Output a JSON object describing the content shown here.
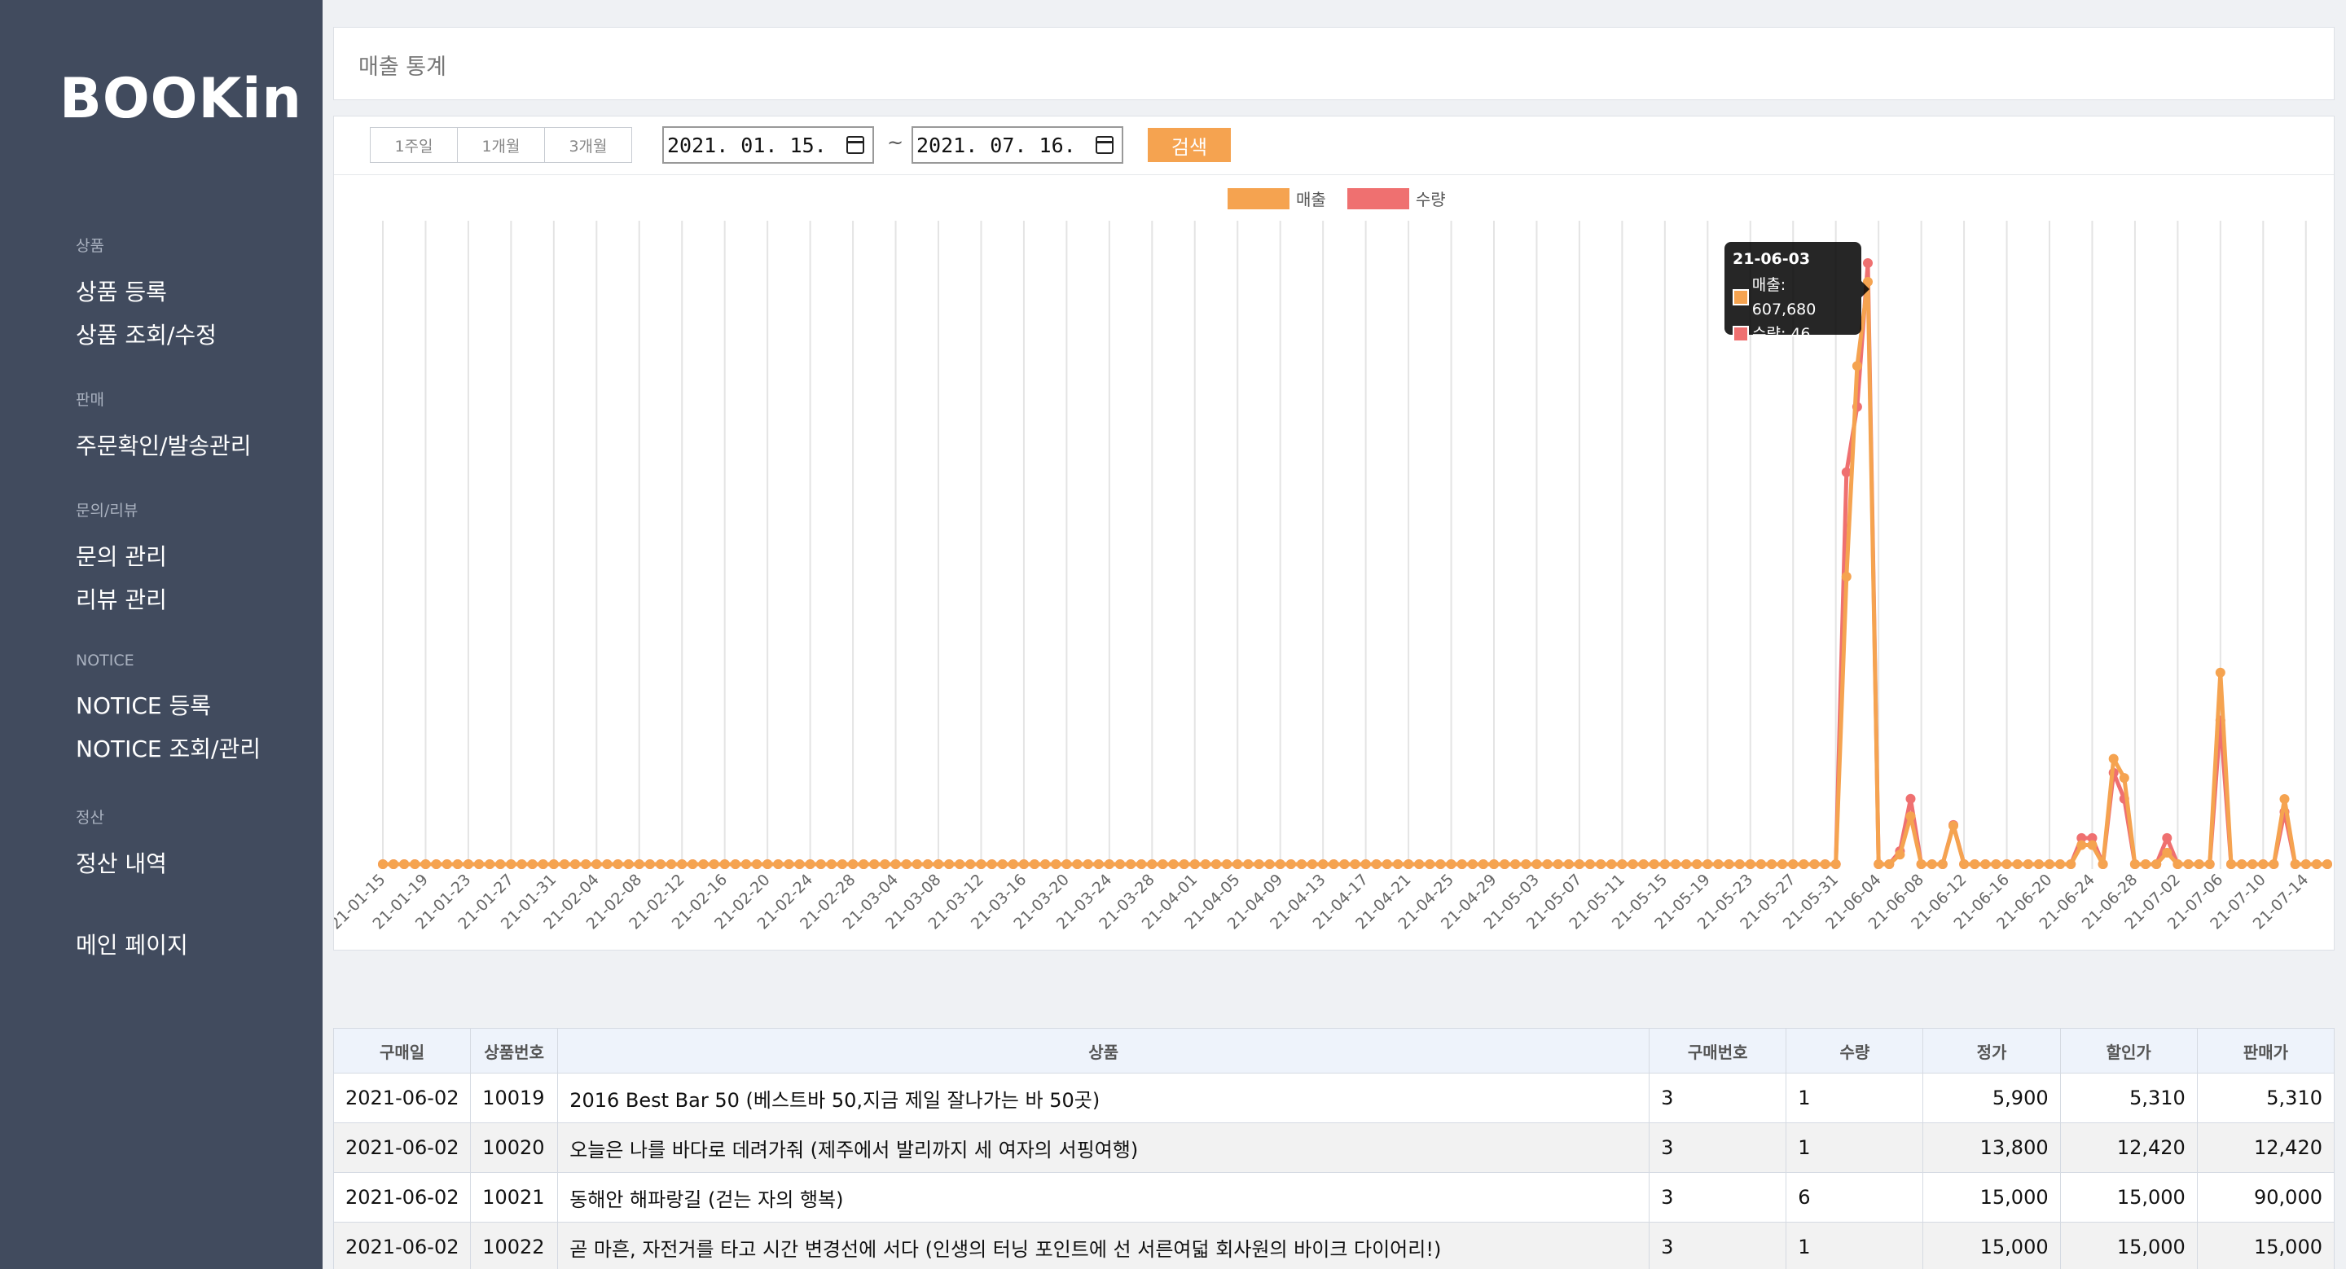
{
  "sidebar": {
    "logo": "BOOKin",
    "sections": [
      {
        "category": "상품",
        "items": [
          "상품 등록",
          "상품 조회/수정"
        ]
      },
      {
        "category": "판매",
        "items": [
          "주문확인/발송관리"
        ]
      },
      {
        "category": "문의/리뷰",
        "items": [
          "문의 관리",
          "리뷰 관리"
        ]
      },
      {
        "category": "NOTICE",
        "items": [
          "NOTICE 등록",
          "NOTICE 조회/관리"
        ]
      },
      {
        "category": "정산",
        "items": [
          "정산 내역"
        ]
      }
    ],
    "main_page": "메인 페이지"
  },
  "header": {
    "title": "매출 통계"
  },
  "filter": {
    "periods": [
      "1주일",
      "1개월",
      "3개월"
    ],
    "start_date": "2021. 01. 15.",
    "end_date": "2021. 07. 16.",
    "separator": "~",
    "search_label": "검색"
  },
  "colors": {
    "sales": "#f5a350",
    "quantity": "#ef7070",
    "sidebar": "#414b5e"
  },
  "tooltip": {
    "date": "21-06-03",
    "sales_text": "매출: 607,680",
    "qty_text": "수량: 46"
  },
  "chart_data": {
    "type": "line",
    "x_start": "2021-01-15",
    "x_end": "2021-07-16",
    "tick_labels": [
      "21-01-15",
      "21-01-19",
      "21-01-23",
      "21-01-27",
      "21-01-31",
      "21-02-04",
      "21-02-08",
      "21-02-12",
      "21-02-16",
      "21-02-20",
      "21-02-24",
      "21-02-28",
      "21-03-04",
      "21-03-08",
      "21-03-12",
      "21-03-16",
      "21-03-20",
      "21-03-24",
      "21-03-28",
      "21-04-01",
      "21-04-05",
      "21-04-09",
      "21-04-13",
      "21-04-17",
      "21-04-21",
      "21-04-25",
      "21-04-29",
      "21-05-03",
      "21-05-07",
      "21-05-11",
      "21-05-15",
      "21-05-19",
      "21-05-23",
      "21-05-27",
      "21-05-31",
      "21-06-04",
      "21-06-08",
      "21-06-12",
      "21-06-16",
      "21-06-20",
      "21-06-24",
      "21-06-28",
      "21-07-02",
      "21-07-06",
      "21-07-10",
      "21-07-14"
    ],
    "series": [
      {
        "name": "매출",
        "color": "#f5a350",
        "points": [
          [
            "2021-06-01",
            300000
          ],
          [
            "2021-06-02",
            520000
          ],
          [
            "2021-06-03",
            607680
          ],
          [
            "2021-06-06",
            10000
          ],
          [
            "2021-06-07",
            50000
          ],
          [
            "2021-06-11",
            40000
          ],
          [
            "2021-06-23",
            20000
          ],
          [
            "2021-06-24",
            20000
          ],
          [
            "2021-06-26",
            110000
          ],
          [
            "2021-06-27",
            90000
          ],
          [
            "2021-07-01",
            12000
          ],
          [
            "2021-07-06",
            200000
          ],
          [
            "2021-07-12",
            68000
          ]
        ]
      },
      {
        "name": "수량",
        "color": "#ef7070",
        "points": [
          [
            "2021-06-01",
            30
          ],
          [
            "2021-06-02",
            35
          ],
          [
            "2021-06-03",
            46
          ],
          [
            "2021-06-06",
            1
          ],
          [
            "2021-06-07",
            5
          ],
          [
            "2021-06-11",
            3
          ],
          [
            "2021-06-23",
            2
          ],
          [
            "2021-06-24",
            2
          ],
          [
            "2021-06-26",
            7
          ],
          [
            "2021-06-27",
            5
          ],
          [
            "2021-07-01",
            2
          ],
          [
            "2021-07-06",
            11
          ],
          [
            "2021-07-12",
            4
          ]
        ]
      }
    ],
    "legend_placement": "top-center",
    "grid": "vertical"
  },
  "table": {
    "headers": [
      "구매일",
      "상품번호",
      "상품",
      "구매번호",
      "수량",
      "정가",
      "할인가",
      "판매가"
    ],
    "rows": [
      [
        "2021-06-02",
        "10019",
        "2016 Best Bar 50 (베스트바 50,지금 제일 잘나가는 바 50곳)",
        "3",
        "1",
        "5,900",
        "5,310",
        "5,310"
      ],
      [
        "2021-06-02",
        "10020",
        "오늘은 나를 바다로 데려가줘 (제주에서 발리까지 세 여자의 서핑여행)",
        "3",
        "1",
        "13,800",
        "12,420",
        "12,420"
      ],
      [
        "2021-06-02",
        "10021",
        "동해안 해파랑길 (걷는 자의 행복)",
        "3",
        "6",
        "15,000",
        "15,000",
        "90,000"
      ],
      [
        "2021-06-02",
        "10022",
        "곧 마흔, 자전거를 타고 시간 변경선에 서다 (인생의 터닝 포인트에 선 서른여덟 회사원의 바이크 다이어리!)",
        "3",
        "1",
        "15,000",
        "15,000",
        "15,000"
      ]
    ]
  }
}
